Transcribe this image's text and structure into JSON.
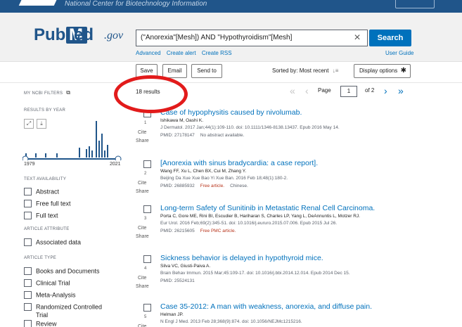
{
  "header": {
    "ncbi_text": "National Center for Biotechnology Information"
  },
  "logo": {
    "pub": "Pub",
    "med": "Med",
    "gov": ".gov"
  },
  "search": {
    "query": "(\"Anorexia\"[Mesh]) AND \"Hypothyroidism\"[Mesh]",
    "clear": "×",
    "button": "Search",
    "links": [
      "Advanced",
      "Create alert",
      "Create RSS"
    ],
    "user_guide": "User Guide"
  },
  "toolbar": {
    "save": "Save",
    "email": "Email",
    "send_to": "Send to",
    "sorted_by": "Sorted by: Most recent",
    "display_options": "Display options"
  },
  "sidebar": {
    "my_ncbi_filters": "MY NCBI FILTERS",
    "results_by_year": "RESULTS BY YEAR",
    "year_start": "1979",
    "year_end": "2021",
    "text_availability": "TEXT AVAILABILITY",
    "text_filters": [
      "Abstract",
      "Free full text",
      "Full text"
    ],
    "article_attribute": "ARTICLE ATTRIBUTE",
    "attribute_filters": [
      "Associated data"
    ],
    "article_type": "ARTICLE TYPE",
    "type_filters": [
      "Books and Documents",
      "Clinical Trial",
      "Meta-Analysis",
      "Randomized Controlled",
      "Trial",
      "Review"
    ]
  },
  "results": {
    "count": "18 results",
    "page_label": "Page",
    "page_value": "1",
    "page_of": "of 2",
    "items": [
      {
        "num": "1",
        "title": "Case of hypophysitis caused by nivolumab.",
        "authors": "Ishikawa M, Oashi K.",
        "journal": "J Dermatol. 2017 Jan;44(1):109-110. doi: 10.1111/1346-8138.13437. Epub 2016 May 14.",
        "pmid": "PMID: 27178147",
        "free": "",
        "extra": "No abstract available."
      },
      {
        "num": "2",
        "title": "[Anorexia with sinus bradycardia: a case report].",
        "authors": "Wang FF, Xu L, Chen BX, Cui M, Zhang Y.",
        "journal": "Beijing Da Xue Xue Bao Yi Xue Ban. 2016 Feb 18;48(1):180-2.",
        "pmid": "PMID: 26885932",
        "free": "Free article.",
        "extra": "Chinese."
      },
      {
        "num": "3",
        "title": "Long-term Safety of Sunitinib in Metastatic Renal Cell Carcinoma.",
        "authors": "Porta C, Gore ME, Rini BI, Escudier B, Hariharan S, Charles LP, Yang L, DeAnnuntis L, Motzer RJ.",
        "journal": "Eur Urol. 2016 Feb;69(2):345-51. doi: 10.1016/j.eururo.2015.07.006. Epub 2015 Jul 26.",
        "pmid": "PMID: 26215605",
        "free": "Free PMC article.",
        "extra": ""
      },
      {
        "num": "4",
        "title": "Sickness behavior is delayed in hypothyroid mice.",
        "authors": "Silva VC, Giusti-Paiva A.",
        "journal": "Brain Behav Immun. 2015 Mar;45:109-17. doi: 10.1016/j.bbi.2014.12.014. Epub 2014 Dec 15.",
        "pmid": "PMID: 25524131",
        "free": "",
        "extra": ""
      },
      {
        "num": "5",
        "title": "Case 35-2012: A man with weakness, anorexia, and diffuse pain.",
        "authors": "Helman JP.",
        "journal": "N Engl J Med. 2013 Feb 28;368(9):874. doi: 10.1056/NEJMc1215216.",
        "pmid": "",
        "free": "",
        "extra": ""
      }
    ],
    "cite": "Cite",
    "share": "Share"
  },
  "colors": {
    "brand": "#20558a",
    "link": "#0071bc",
    "highlight": "#e21b1b",
    "free_article": "#b8341b"
  }
}
